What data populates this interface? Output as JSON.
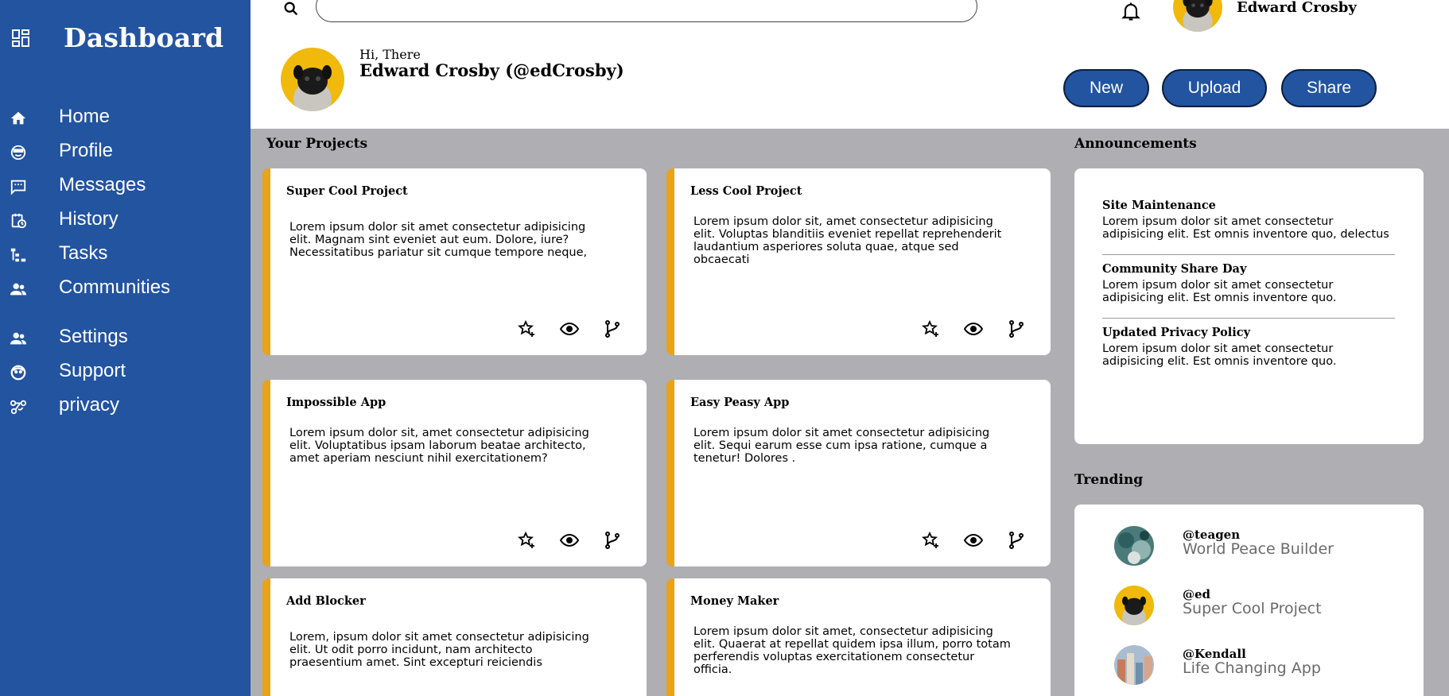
{
  "app": {
    "title": "Dashboard"
  },
  "sidebar": {
    "items": [
      {
        "label": "Home",
        "icon": "home-icon"
      },
      {
        "label": "Profile",
        "icon": "profile-icon"
      },
      {
        "label": "Messages",
        "icon": "messages-icon"
      },
      {
        "label": "History",
        "icon": "history-icon"
      },
      {
        "label": "Tasks",
        "icon": "tasks-icon"
      },
      {
        "label": "Communities",
        "icon": "communities-icon"
      }
    ],
    "secondary_items": [
      {
        "label": "Settings",
        "icon": "settings-icon"
      },
      {
        "label": "Support",
        "icon": "support-icon"
      },
      {
        "label": "privacy",
        "icon": "privacy-icon"
      }
    ]
  },
  "header": {
    "search": {
      "value": "",
      "placeholder": ""
    },
    "user_name": "Edward Crosby",
    "greeting": "Hi, There",
    "full_name": "Edward Crosby (@edCrosby)",
    "buttons": {
      "new": "New",
      "upload": "Upload",
      "share": "Share"
    }
  },
  "projects": {
    "title": "Your Projects",
    "items": [
      {
        "title": "Super Cool Project",
        "description": "Lorem ipsum dolor sit amet consectetur adipisicing elit. Magnam sint eveniet aut eum. Dolore, iure? Necessitatibus pariatur sit cumque tempore neque,"
      },
      {
        "title": "Less Cool Project",
        "description": "Lorem ipsum dolor sit, amet consectetur adipisicing elit. Voluptas blanditiis eveniet repellat reprehenderit laudantium asperiores soluta quae, atque sed obcaecati"
      },
      {
        "title": "Impossible App",
        "description": "Lorem ipsum dolor sit, amet consectetur adipisicing elit. Voluptatibus ipsam laborum beatae architecto, amet aperiam nesciunt nihil exercitationem?"
      },
      {
        "title": "Easy Peasy App",
        "description": "Lorem ipsum dolor sit amet consectetur adipisicing elit. Sequi earum esse cum ipsa ratione, cumque a tenetur! Dolores ."
      },
      {
        "title": "Add Blocker",
        "description": "Lorem, ipsum dolor sit amet consectetur adipisicing elit. Ut odit porro incidunt, nam architecto praesentium amet. Sint excepturi reiciendis"
      },
      {
        "title": "Money Maker",
        "description": "Lorem ipsum dolor sit amet, consectetur adipisicing elit. Quaerat at repellat quidem ipsa illum, porro totam perferendis voluptas exercitationem consectetur officia."
      }
    ]
  },
  "announcements": {
    "title": "Announcements",
    "items": [
      {
        "title": "Site Maintenance",
        "body": "Lorem ipsum dolor sit amet consectetur adipisicing elit. Est omnis inventore quo, delectus"
      },
      {
        "title": "Community Share Day",
        "body": "Lorem ipsum dolor sit amet consectetur adipisicing elit. Est omnis inventore quo."
      },
      {
        "title": "Updated Privacy Policy",
        "body": "Lorem ipsum dolor sit amet consectetur adipisicing elit. Est omnis inventore quo."
      }
    ]
  },
  "trending": {
    "title": "Trending",
    "items": [
      {
        "handle": "@teagen",
        "project": "World Peace Builder"
      },
      {
        "handle": "@ed",
        "project": "Super Cool Project"
      },
      {
        "handle": "@Kendall",
        "project": "Life Changing App"
      }
    ]
  },
  "colors": {
    "primary": "#2254a0",
    "accent": "#e8a319",
    "background": "#aeaeb3",
    "avatar_yellow": "#f0b90b"
  }
}
